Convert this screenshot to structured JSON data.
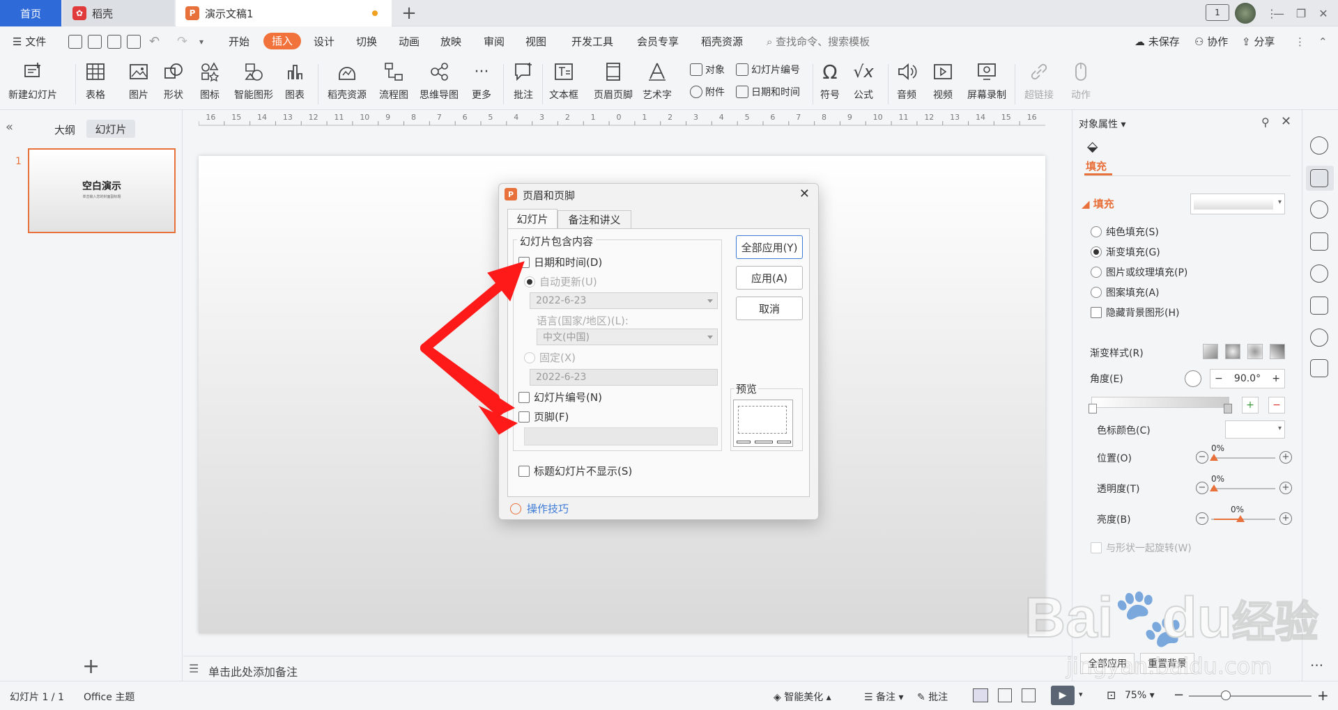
{
  "tabs": {
    "home": "首页",
    "daoke": "稻壳",
    "doc": "演示文稿1",
    "page_num": "1"
  },
  "menu": {
    "file": "文件",
    "items": [
      "开始",
      "插入",
      "设计",
      "切换",
      "动画",
      "放映",
      "审阅",
      "视图",
      "开发工具",
      "会员专享",
      "稻壳资源"
    ],
    "search_placeholder": "查找命令、搜索模板",
    "unsaved": "未保存",
    "collab": "协作",
    "share": "分享"
  },
  "ribbon": {
    "new_slide": "新建幻灯片",
    "table": "表格",
    "picture": "图片",
    "shape": "形状",
    "icon": "图标",
    "smart_art": "智能图形",
    "chart": "图表",
    "daoke_res": "稻壳资源",
    "flowchart": "流程图",
    "mindmap": "思维导图",
    "more": "更多",
    "comment": "批注",
    "textbox": "文本框",
    "header_footer": "页眉页脚",
    "wordart": "艺术字",
    "object": "对象",
    "slide_number": "幻灯片编号",
    "attachment": "附件",
    "datetime": "日期和时间",
    "symbol": "符号",
    "formula": "公式",
    "audio": "音频",
    "video": "视频",
    "screen_record": "屏幕录制",
    "hyperlink": "超链接",
    "action": "动作"
  },
  "left": {
    "outline_tab": "大纲",
    "slides_tab": "幻灯片",
    "slide_index": "1",
    "thumb_title": "空白演示",
    "thumb_sub": "单击输入您的封面副标题"
  },
  "ruler": [
    "16",
    "15",
    "14",
    "13",
    "12",
    "11",
    "10",
    "9",
    "8",
    "7",
    "6",
    "5",
    "4",
    "3",
    "2",
    "1",
    "0",
    "1",
    "2",
    "3",
    "4",
    "5",
    "6",
    "7",
    "8",
    "9",
    "10",
    "11",
    "12",
    "13",
    "14",
    "15",
    "16"
  ],
  "notes_placeholder": "单击此处添加备注",
  "right": {
    "title": "对象属性",
    "fill_tab": "填充",
    "fill_section": "填充",
    "solid": "纯色填充(S)",
    "gradient": "渐变填充(G)",
    "picture_texture": "图片或纹理填充(P)",
    "pattern": "图案填充(A)",
    "hide_bg": "隐藏背景图形(H)",
    "gradient_style": "渐变样式(R)",
    "angle": "角度(E)",
    "angle_value": "90.0°",
    "stop_color": "色标颜色(C)",
    "position": "位置(O)",
    "transparency": "透明度(T)",
    "brightness": "亮度(B)",
    "position_value": "0%",
    "transparency_value": "0%",
    "brightness_value": "0%",
    "rotate_with_shape": "与形状一起旋转(W)",
    "apply_all": "全部应用",
    "reset_bg": "重置背景"
  },
  "status": {
    "slide_count": "幻灯片 1 / 1",
    "theme": "Office 主题",
    "beautify": "智能美化",
    "notes": "备注",
    "comments": "批注",
    "zoom": "75%"
  },
  "dialog": {
    "title": "页眉和页脚",
    "tab_slide": "幻灯片",
    "tab_notes": "备注和讲义",
    "group_title": "幻灯片包含内容",
    "datetime": "日期和时间(D)",
    "auto_update": "自动更新(U)",
    "auto_date": "2022-6-23",
    "language_label": "语言(国家/地区)(L):",
    "language_value": "中文(中国)",
    "fixed": "固定(X)",
    "fixed_date": "2022-6-23",
    "slide_number": "幻灯片编号(N)",
    "footer": "页脚(F)",
    "hide_on_title": "标题幻灯片不显示(S)",
    "apply_all": "全部应用(Y)",
    "apply": "应用(A)",
    "cancel": "取消",
    "preview": "预览",
    "tips": "操作技巧"
  },
  "watermark": {
    "brand": "Bai",
    "brand2": "du",
    "cn": "经验",
    "url": "jingyan.baidu.com"
  },
  "colors": {
    "accent": "#f2723b",
    "blue": "#2f6bd8",
    "arrow": "#ff1a1a"
  }
}
